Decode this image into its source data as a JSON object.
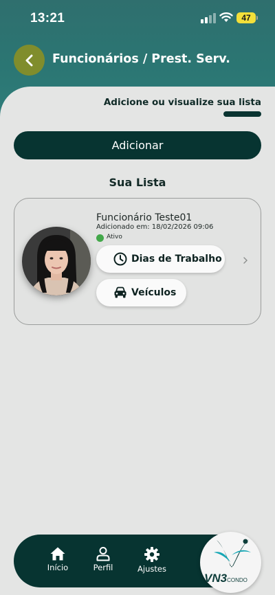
{
  "status_bar": {
    "time": "13:21",
    "battery": "47",
    "battery_color": "#f3df3a"
  },
  "header": {
    "title": "Funcionários / Prest. Serv.",
    "back_icon": "chevron-left-icon",
    "accent_color": "#2f7d7a"
  },
  "main": {
    "subtitle": "Adicione ou visualize sua lista",
    "add_button_label": "Adicionar",
    "list_title": "Sua Lista",
    "primary_color": "#073431"
  },
  "employees": [
    {
      "name": "Funcionário Teste01",
      "added": "Adicionado em: 18/02/2026 09:06",
      "status": "Ativo",
      "status_color": "#43a84a",
      "actions": [
        {
          "label": "Dias de Trabalho",
          "icon": "clock-icon"
        },
        {
          "label": "Veículos",
          "icon": "car-icon"
        }
      ]
    }
  ],
  "bottom_nav": {
    "items": [
      {
        "label": "Início",
        "icon": "home-icon"
      },
      {
        "label": "Perfil",
        "icon": "user-icon"
      },
      {
        "label": "Ajustes",
        "icon": "gear-icon"
      }
    ]
  },
  "logo": {
    "text_main": "VN3",
    "text_sub": "CONDO"
  }
}
